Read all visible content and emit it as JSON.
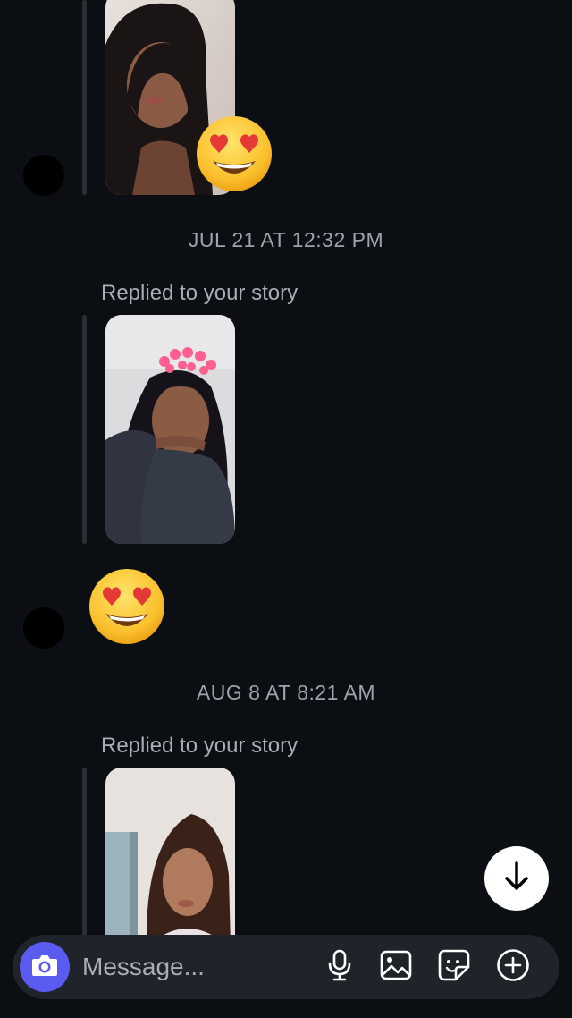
{
  "thread": {
    "timestamps": [
      "JUL 21 AT 12:32 PM",
      "AUG 8 AT 8:21 AM"
    ],
    "replied_label": "Replied to your story"
  },
  "composer": {
    "placeholder": "Message..."
  },
  "colors": {
    "background": "#0b0f14",
    "accent": "#5b5bf2",
    "composer": "#1f242b"
  },
  "icons": [
    "camera-icon",
    "microphone-icon",
    "gallery-icon",
    "sticker-icon",
    "plus-icon",
    "arrow-down-icon",
    "heart-eyes-emoji"
  ]
}
